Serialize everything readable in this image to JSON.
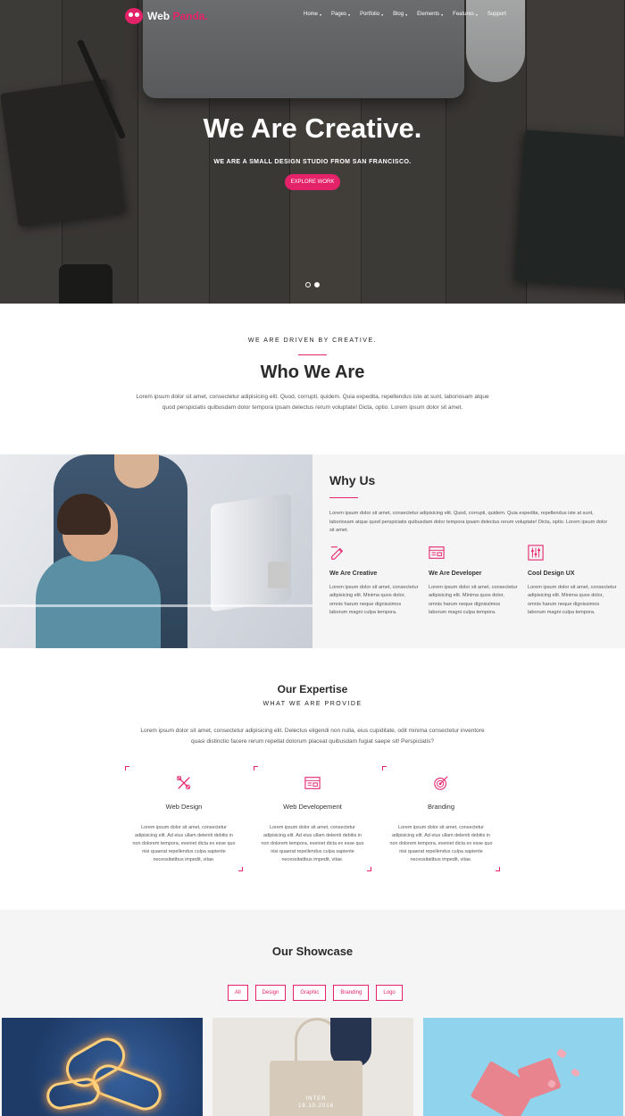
{
  "brand": {
    "name_part1": "Web",
    "name_part2": " Panda.",
    "accent": "#e4226a"
  },
  "nav": {
    "items": [
      {
        "label": "Home",
        "dropdown": true
      },
      {
        "label": "Pages",
        "dropdown": true
      },
      {
        "label": "Portfolio",
        "dropdown": true
      },
      {
        "label": "Blog",
        "dropdown": true
      },
      {
        "label": "Elements",
        "dropdown": true
      },
      {
        "label": "Features",
        "dropdown": true
      },
      {
        "label": "Support",
        "dropdown": false
      }
    ]
  },
  "hero": {
    "title": "We Are Creative.",
    "subtitle": "WE ARE A SMALL DESIGN STUDIO FROM SAN FRANCISCO.",
    "button": "EXPLORE WORK",
    "slides": 2,
    "active_slide": 2
  },
  "who": {
    "eyebrow": "WE ARE DRIVEN BY CREATIVE.",
    "title": "Who We Are",
    "line1": "Lorem ipsum dolor sit amet, consectetur adipisicing elit. Quod, corrupti, quidem. Quia expedita, repellendus iste at sunt, laboriosam atque",
    "line2": "quod perspiciatis quibusdam dolor tempora ipsam delectus rerum voluptate! Dicta, optio. Lorem ipsum dolor sit amet."
  },
  "why": {
    "title": "Why Us",
    "para": "Lorem ipsum dolor sit amet, consectetur adipisicing elit. Quod, corrupti, quidem. Quia expedita, repellendus iste at sunt, laboriosam atque quod perspiciatis quibusdam dolor tempora ipsam delectus rerum voluptate! Dicta, optio. Lorem ipsum dolor sit amet.",
    "features": [
      {
        "icon": "pencil-icon",
        "title": "We Are Creative",
        "text": "Lorem ipsum dolor sit amet, consectetur adipisicing elit. Minima quos dolor, omnis harum neque dignissimos laborum magni culpa tempora."
      },
      {
        "icon": "browser-icon",
        "title": "We Are Developer",
        "text": "Lorem ipsum dolor sit amet, consectetur adipisicing elit. Minima quos dolor, omnis harum neque dignissimos laborum magni culpa tempora."
      },
      {
        "icon": "sliders-icon",
        "title": "Cool Design UX",
        "text": "Lorem ipsum dolor sit amet, consectetur adipisicing elit. Minima quos dolor, omnis harum neque dignissimos laborum magni culpa tempora."
      }
    ]
  },
  "expertise": {
    "title": "Our Expertise",
    "eyebrow": "WHAT WE ARE PROVIDE",
    "line1": "Lorem ipsum dolor sit amet, consectetur adipisicing elit. Delectus eligendi non nulla, eius cupiditate, odit minima consectetur inventore",
    "line2": "quasi distinctio facere rerum repellat dolorum placeat quibusdam fugiat saepe sit! Perspiciatis?",
    "cards": [
      {
        "icon": "design-tools-icon",
        "title": "Web Design",
        "text": "Lorem ipsum dolor sit amet, consectetur adipisicing elit. Ad eius ullam deleniti debitis in non dolorem tempora, eveniet dicta ex esse quo nisi quaerat repellendus culpa sapiente necessitatibus impedit, vitae."
      },
      {
        "icon": "browser-window-icon",
        "title": "Web Developement",
        "text": "Lorem ipsum dolor sit amet, consectetur adipisicing elit. Ad eius ullam deleniti debitis in non dolorem tempora, eveniet dicta ex esse quo nisi quaerat repellendus culpa sapiente necessitatibus impedit, vitae."
      },
      {
        "icon": "target-icon",
        "title": "Branding",
        "text": "Lorem ipsum dolor sit amet, consectetur adipisicing elit. Ad eius ullam deleniti debitis in non dolorem tempora, eveniet dicta ex esse quo nisi quaerat repellendus culpa sapiente necessitatibus impedit, vitae."
      }
    ]
  },
  "showcase": {
    "title": "Our Showcase",
    "filters": [
      "All",
      "Design",
      "Graphic",
      "Branding",
      "Logo"
    ],
    "bag_line1": "INTER",
    "bag_line2": "19.10.2016"
  }
}
